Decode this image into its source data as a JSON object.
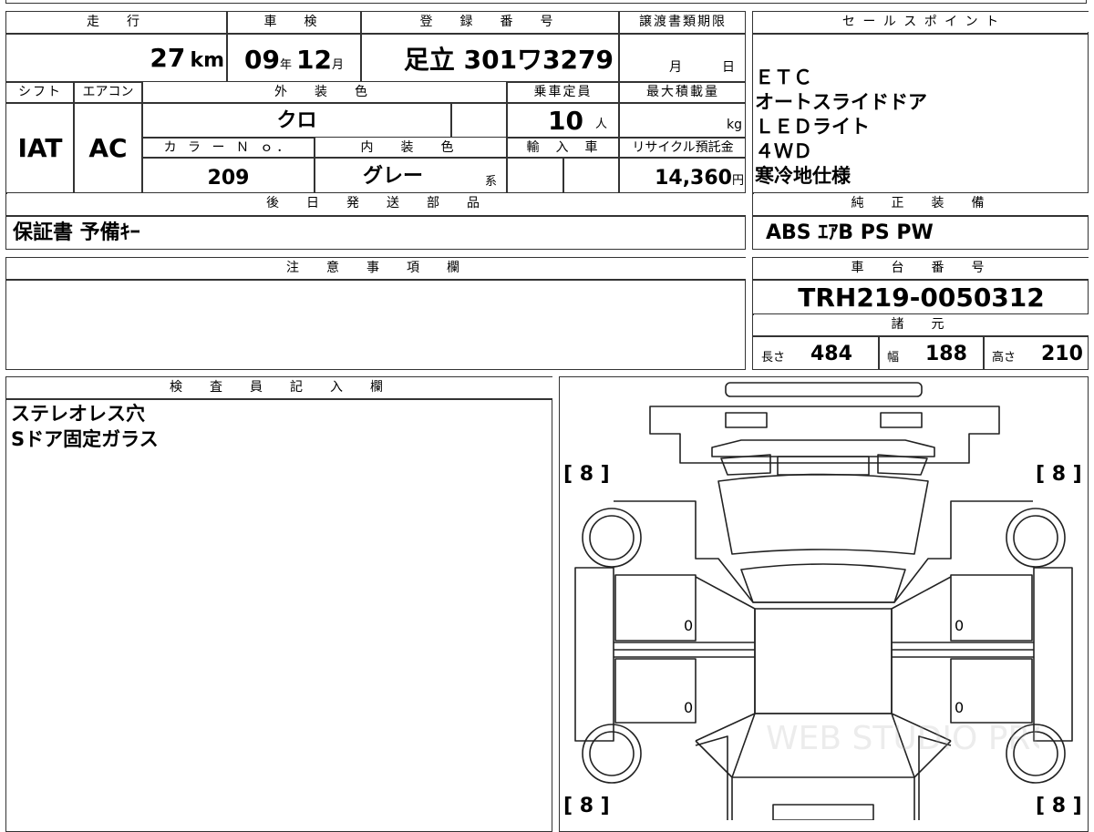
{
  "top_table": {
    "headers": {
      "mileage": "走　行",
      "inspection": "車　検",
      "registration": "登　録　番　号",
      "transfer_deadline": "譲渡書類期限",
      "shift": "シフト",
      "aircon": "エアコン",
      "exterior_color": "外　装　色",
      "capacity": "乗車定員",
      "max_load": "最大積載量",
      "color_no": "カ ラ ー Ｎ ｏ．",
      "interior_color": "内　装　色",
      "import": "輸　入　車",
      "recycle": "リサイクル預託金",
      "later_parts": "後　日　発　送　部　品"
    },
    "mileage_value": "27",
    "mileage_unit": "km",
    "inspection_year": "09",
    "inspection_year_unit": "年",
    "inspection_month": "12",
    "inspection_month_unit": "月",
    "registration_value": "足立 301ワ3279",
    "deadline_month_unit": "月",
    "deadline_day_unit": "日",
    "shift_value": "IAT",
    "aircon_value": "AC",
    "exterior_value": "クロ",
    "capacity_value": "10",
    "capacity_unit": "人",
    "max_load_unit": "kg",
    "color_no_value": "209",
    "interior_value": "グレー",
    "interior_suffix": "系",
    "recycle_value": "14,360",
    "recycle_unit": "円",
    "later_parts_value": "保証書 予備ｷｰ"
  },
  "sale_points": {
    "header": "セ ー ル ス ポ イ ン ト",
    "items": [
      "ＥＴＣ",
      "オートスライドドア",
      "ＬＥＤライト",
      "４ＷＤ",
      "寒冷地仕様"
    ]
  },
  "standard_equipment": {
    "header": "純　正　装　備",
    "value": "ABS ｴｱB PS PW"
  },
  "notes": {
    "header": "注　意　事　項　欄"
  },
  "chassis": {
    "header": "車　台　番　号",
    "value": "TRH219-0050312"
  },
  "specs": {
    "header": "諸　元",
    "length_label": "長さ",
    "length_value": "484",
    "width_label": "幅",
    "width_value": "188",
    "height_label": "高さ",
    "height_value": "210"
  },
  "inspector": {
    "header": "検　査　員　記　入　欄",
    "items": [
      "ステレオレス穴",
      "Sドア固定ガラス"
    ]
  },
  "diagram": {
    "tire_front_left": "[ 8 ]",
    "tire_front_right": "[ 8 ]",
    "tire_rear_left": "[ 8 ]",
    "tire_rear_right": "[ 8 ]",
    "door_left_front": "0",
    "door_left_rear": "0",
    "door_right_front": "0",
    "door_right_rear": "0",
    "watermark": "WEB STUDIO PRO"
  }
}
